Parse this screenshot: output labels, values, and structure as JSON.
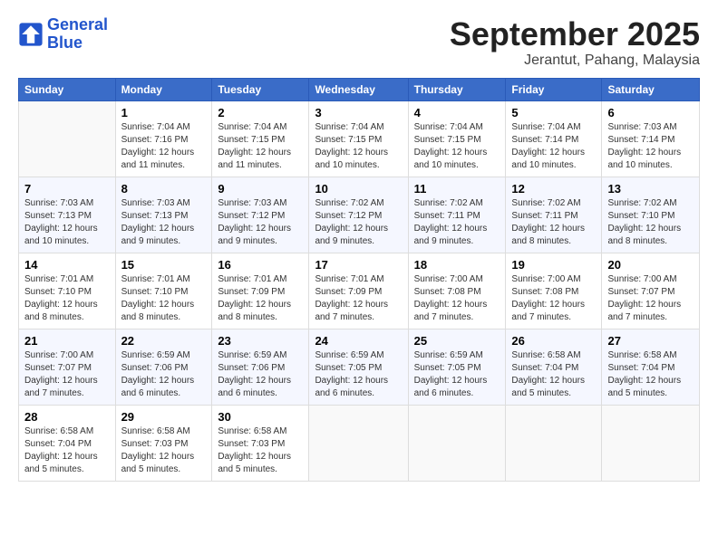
{
  "logo": {
    "text1": "General",
    "text2": "Blue"
  },
  "title": "September 2025",
  "location": "Jerantut, Pahang, Malaysia",
  "days_of_week": [
    "Sunday",
    "Monday",
    "Tuesday",
    "Wednesday",
    "Thursday",
    "Friday",
    "Saturday"
  ],
  "weeks": [
    [
      {
        "day": "",
        "sunrise": "",
        "sunset": "",
        "daylight": ""
      },
      {
        "day": "1",
        "sunrise": "Sunrise: 7:04 AM",
        "sunset": "Sunset: 7:16 PM",
        "daylight": "Daylight: 12 hours and 11 minutes."
      },
      {
        "day": "2",
        "sunrise": "Sunrise: 7:04 AM",
        "sunset": "Sunset: 7:15 PM",
        "daylight": "Daylight: 12 hours and 11 minutes."
      },
      {
        "day": "3",
        "sunrise": "Sunrise: 7:04 AM",
        "sunset": "Sunset: 7:15 PM",
        "daylight": "Daylight: 12 hours and 10 minutes."
      },
      {
        "day": "4",
        "sunrise": "Sunrise: 7:04 AM",
        "sunset": "Sunset: 7:15 PM",
        "daylight": "Daylight: 12 hours and 10 minutes."
      },
      {
        "day": "5",
        "sunrise": "Sunrise: 7:04 AM",
        "sunset": "Sunset: 7:14 PM",
        "daylight": "Daylight: 12 hours and 10 minutes."
      },
      {
        "day": "6",
        "sunrise": "Sunrise: 7:03 AM",
        "sunset": "Sunset: 7:14 PM",
        "daylight": "Daylight: 12 hours and 10 minutes."
      }
    ],
    [
      {
        "day": "7",
        "sunrise": "Sunrise: 7:03 AM",
        "sunset": "Sunset: 7:13 PM",
        "daylight": "Daylight: 12 hours and 10 minutes."
      },
      {
        "day": "8",
        "sunrise": "Sunrise: 7:03 AM",
        "sunset": "Sunset: 7:13 PM",
        "daylight": "Daylight: 12 hours and 9 minutes."
      },
      {
        "day": "9",
        "sunrise": "Sunrise: 7:03 AM",
        "sunset": "Sunset: 7:12 PM",
        "daylight": "Daylight: 12 hours and 9 minutes."
      },
      {
        "day": "10",
        "sunrise": "Sunrise: 7:02 AM",
        "sunset": "Sunset: 7:12 PM",
        "daylight": "Daylight: 12 hours and 9 minutes."
      },
      {
        "day": "11",
        "sunrise": "Sunrise: 7:02 AM",
        "sunset": "Sunset: 7:11 PM",
        "daylight": "Daylight: 12 hours and 9 minutes."
      },
      {
        "day": "12",
        "sunrise": "Sunrise: 7:02 AM",
        "sunset": "Sunset: 7:11 PM",
        "daylight": "Daylight: 12 hours and 8 minutes."
      },
      {
        "day": "13",
        "sunrise": "Sunrise: 7:02 AM",
        "sunset": "Sunset: 7:10 PM",
        "daylight": "Daylight: 12 hours and 8 minutes."
      }
    ],
    [
      {
        "day": "14",
        "sunrise": "Sunrise: 7:01 AM",
        "sunset": "Sunset: 7:10 PM",
        "daylight": "Daylight: 12 hours and 8 minutes."
      },
      {
        "day": "15",
        "sunrise": "Sunrise: 7:01 AM",
        "sunset": "Sunset: 7:10 PM",
        "daylight": "Daylight: 12 hours and 8 minutes."
      },
      {
        "day": "16",
        "sunrise": "Sunrise: 7:01 AM",
        "sunset": "Sunset: 7:09 PM",
        "daylight": "Daylight: 12 hours and 8 minutes."
      },
      {
        "day": "17",
        "sunrise": "Sunrise: 7:01 AM",
        "sunset": "Sunset: 7:09 PM",
        "daylight": "Daylight: 12 hours and 7 minutes."
      },
      {
        "day": "18",
        "sunrise": "Sunrise: 7:00 AM",
        "sunset": "Sunset: 7:08 PM",
        "daylight": "Daylight: 12 hours and 7 minutes."
      },
      {
        "day": "19",
        "sunrise": "Sunrise: 7:00 AM",
        "sunset": "Sunset: 7:08 PM",
        "daylight": "Daylight: 12 hours and 7 minutes."
      },
      {
        "day": "20",
        "sunrise": "Sunrise: 7:00 AM",
        "sunset": "Sunset: 7:07 PM",
        "daylight": "Daylight: 12 hours and 7 minutes."
      }
    ],
    [
      {
        "day": "21",
        "sunrise": "Sunrise: 7:00 AM",
        "sunset": "Sunset: 7:07 PM",
        "daylight": "Daylight: 12 hours and 7 minutes."
      },
      {
        "day": "22",
        "sunrise": "Sunrise: 6:59 AM",
        "sunset": "Sunset: 7:06 PM",
        "daylight": "Daylight: 12 hours and 6 minutes."
      },
      {
        "day": "23",
        "sunrise": "Sunrise: 6:59 AM",
        "sunset": "Sunset: 7:06 PM",
        "daylight": "Daylight: 12 hours and 6 minutes."
      },
      {
        "day": "24",
        "sunrise": "Sunrise: 6:59 AM",
        "sunset": "Sunset: 7:05 PM",
        "daylight": "Daylight: 12 hours and 6 minutes."
      },
      {
        "day": "25",
        "sunrise": "Sunrise: 6:59 AM",
        "sunset": "Sunset: 7:05 PM",
        "daylight": "Daylight: 12 hours and 6 minutes."
      },
      {
        "day": "26",
        "sunrise": "Sunrise: 6:58 AM",
        "sunset": "Sunset: 7:04 PM",
        "daylight": "Daylight: 12 hours and 5 minutes."
      },
      {
        "day": "27",
        "sunrise": "Sunrise: 6:58 AM",
        "sunset": "Sunset: 7:04 PM",
        "daylight": "Daylight: 12 hours and 5 minutes."
      }
    ],
    [
      {
        "day": "28",
        "sunrise": "Sunrise: 6:58 AM",
        "sunset": "Sunset: 7:04 PM",
        "daylight": "Daylight: 12 hours and 5 minutes."
      },
      {
        "day": "29",
        "sunrise": "Sunrise: 6:58 AM",
        "sunset": "Sunset: 7:03 PM",
        "daylight": "Daylight: 12 hours and 5 minutes."
      },
      {
        "day": "30",
        "sunrise": "Sunrise: 6:58 AM",
        "sunset": "Sunset: 7:03 PM",
        "daylight": "Daylight: 12 hours and 5 minutes."
      },
      {
        "day": "",
        "sunrise": "",
        "sunset": "",
        "daylight": ""
      },
      {
        "day": "",
        "sunrise": "",
        "sunset": "",
        "daylight": ""
      },
      {
        "day": "",
        "sunrise": "",
        "sunset": "",
        "daylight": ""
      },
      {
        "day": "",
        "sunrise": "",
        "sunset": "",
        "daylight": ""
      }
    ]
  ]
}
